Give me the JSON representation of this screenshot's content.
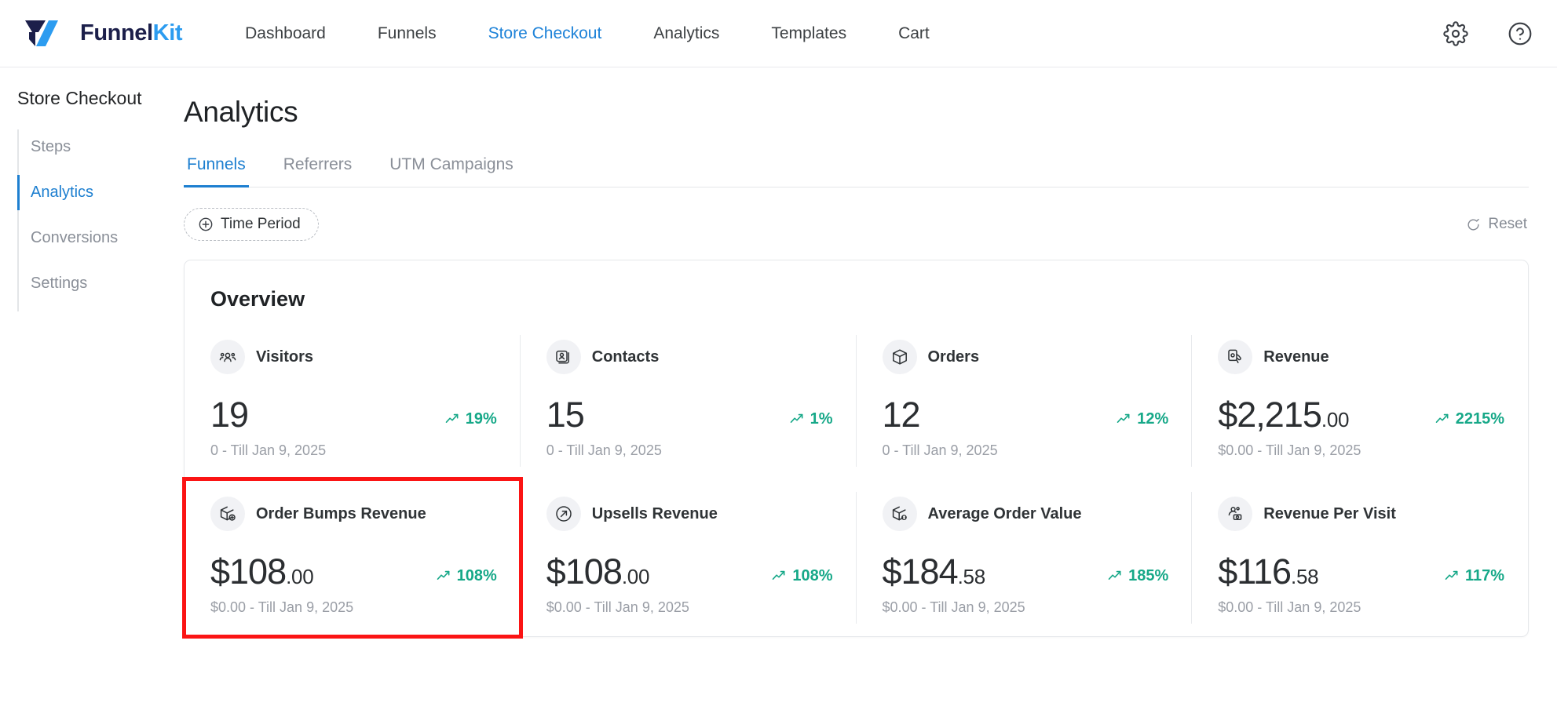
{
  "header": {
    "brand": {
      "part1": "Funnel",
      "part2": "Kit",
      "logo_icon": "funnelkit-logo-icon"
    },
    "nav": [
      {
        "label": "Dashboard",
        "active": false
      },
      {
        "label": "Funnels",
        "active": false
      },
      {
        "label": "Store Checkout",
        "active": true
      },
      {
        "label": "Analytics",
        "active": false
      },
      {
        "label": "Templates",
        "active": false
      },
      {
        "label": "Cart",
        "active": false
      }
    ],
    "settings_icon": "gear-icon",
    "help_icon": "help-circle-icon"
  },
  "sidebar": {
    "title": "Store Checkout",
    "items": [
      {
        "label": "Steps",
        "active": false
      },
      {
        "label": "Analytics",
        "active": true
      },
      {
        "label": "Conversions",
        "active": false
      },
      {
        "label": "Settings",
        "active": false
      }
    ]
  },
  "main": {
    "page_title": "Analytics",
    "tabs": [
      {
        "label": "Funnels",
        "active": true
      },
      {
        "label": "Referrers",
        "active": false
      },
      {
        "label": "UTM Campaigns",
        "active": false
      }
    ],
    "time_period_label": "Time Period",
    "time_period_icon": "plus-circle-icon",
    "reset_label": "Reset",
    "reset_icon": "refresh-icon",
    "overview_title": "Overview"
  },
  "colors": {
    "accent": "#1d7fd0",
    "brand_blue": "#2c9cf0",
    "brand_dark": "#1c1f4a",
    "positive": "#16a888",
    "highlight_outline": "#fb1414"
  },
  "metrics": [
    {
      "label": "Visitors",
      "icon": "visitors-group-icon",
      "value": "19",
      "cents": "",
      "delta": "19%",
      "delta_icon": "trend-up-icon",
      "sub": "0 - Till Jan 9, 2025",
      "highlight": false
    },
    {
      "label": "Contacts",
      "icon": "contacts-card-icon",
      "value": "15",
      "cents": "",
      "delta": "1%",
      "delta_icon": "trend-up-icon",
      "sub": "0 - Till Jan 9, 2025",
      "highlight": false
    },
    {
      "label": "Orders",
      "icon": "box-icon",
      "value": "12",
      "cents": "",
      "delta": "12%",
      "delta_icon": "trend-up-icon",
      "sub": "0 - Till Jan 9, 2025",
      "highlight": false
    },
    {
      "label": "Revenue",
      "icon": "revenue-hand-icon",
      "value": "$2,215",
      "cents": ".00",
      "delta": "2215%",
      "delta_icon": "trend-up-icon",
      "sub": "$0.00 - Till Jan 9, 2025",
      "highlight": false
    },
    {
      "label": "Order Bumps Revenue",
      "icon": "box-plus-icon",
      "value": "$108",
      "cents": ".00",
      "delta": "108%",
      "delta_icon": "trend-up-icon",
      "sub": "$0.00 - Till Jan 9, 2025",
      "highlight": true
    },
    {
      "label": "Upsells Revenue",
      "icon": "arrow-up-right-circle-icon",
      "value": "$108",
      "cents": ".00",
      "delta": "108%",
      "delta_icon": "trend-up-icon",
      "sub": "$0.00 - Till Jan 9, 2025",
      "highlight": false
    },
    {
      "label": "Average Order Value",
      "icon": "box-dollar-icon",
      "value": "$184",
      "cents": ".58",
      "delta": "185%",
      "delta_icon": "trend-up-icon",
      "sub": "$0.00 - Till Jan 9, 2025",
      "highlight": false
    },
    {
      "label": "Revenue Per Visit",
      "icon": "person-money-icon",
      "value": "$116",
      "cents": ".58",
      "delta": "117%",
      "delta_icon": "trend-up-icon",
      "sub": "$0.00 - Till Jan 9, 2025",
      "highlight": false
    }
  ]
}
